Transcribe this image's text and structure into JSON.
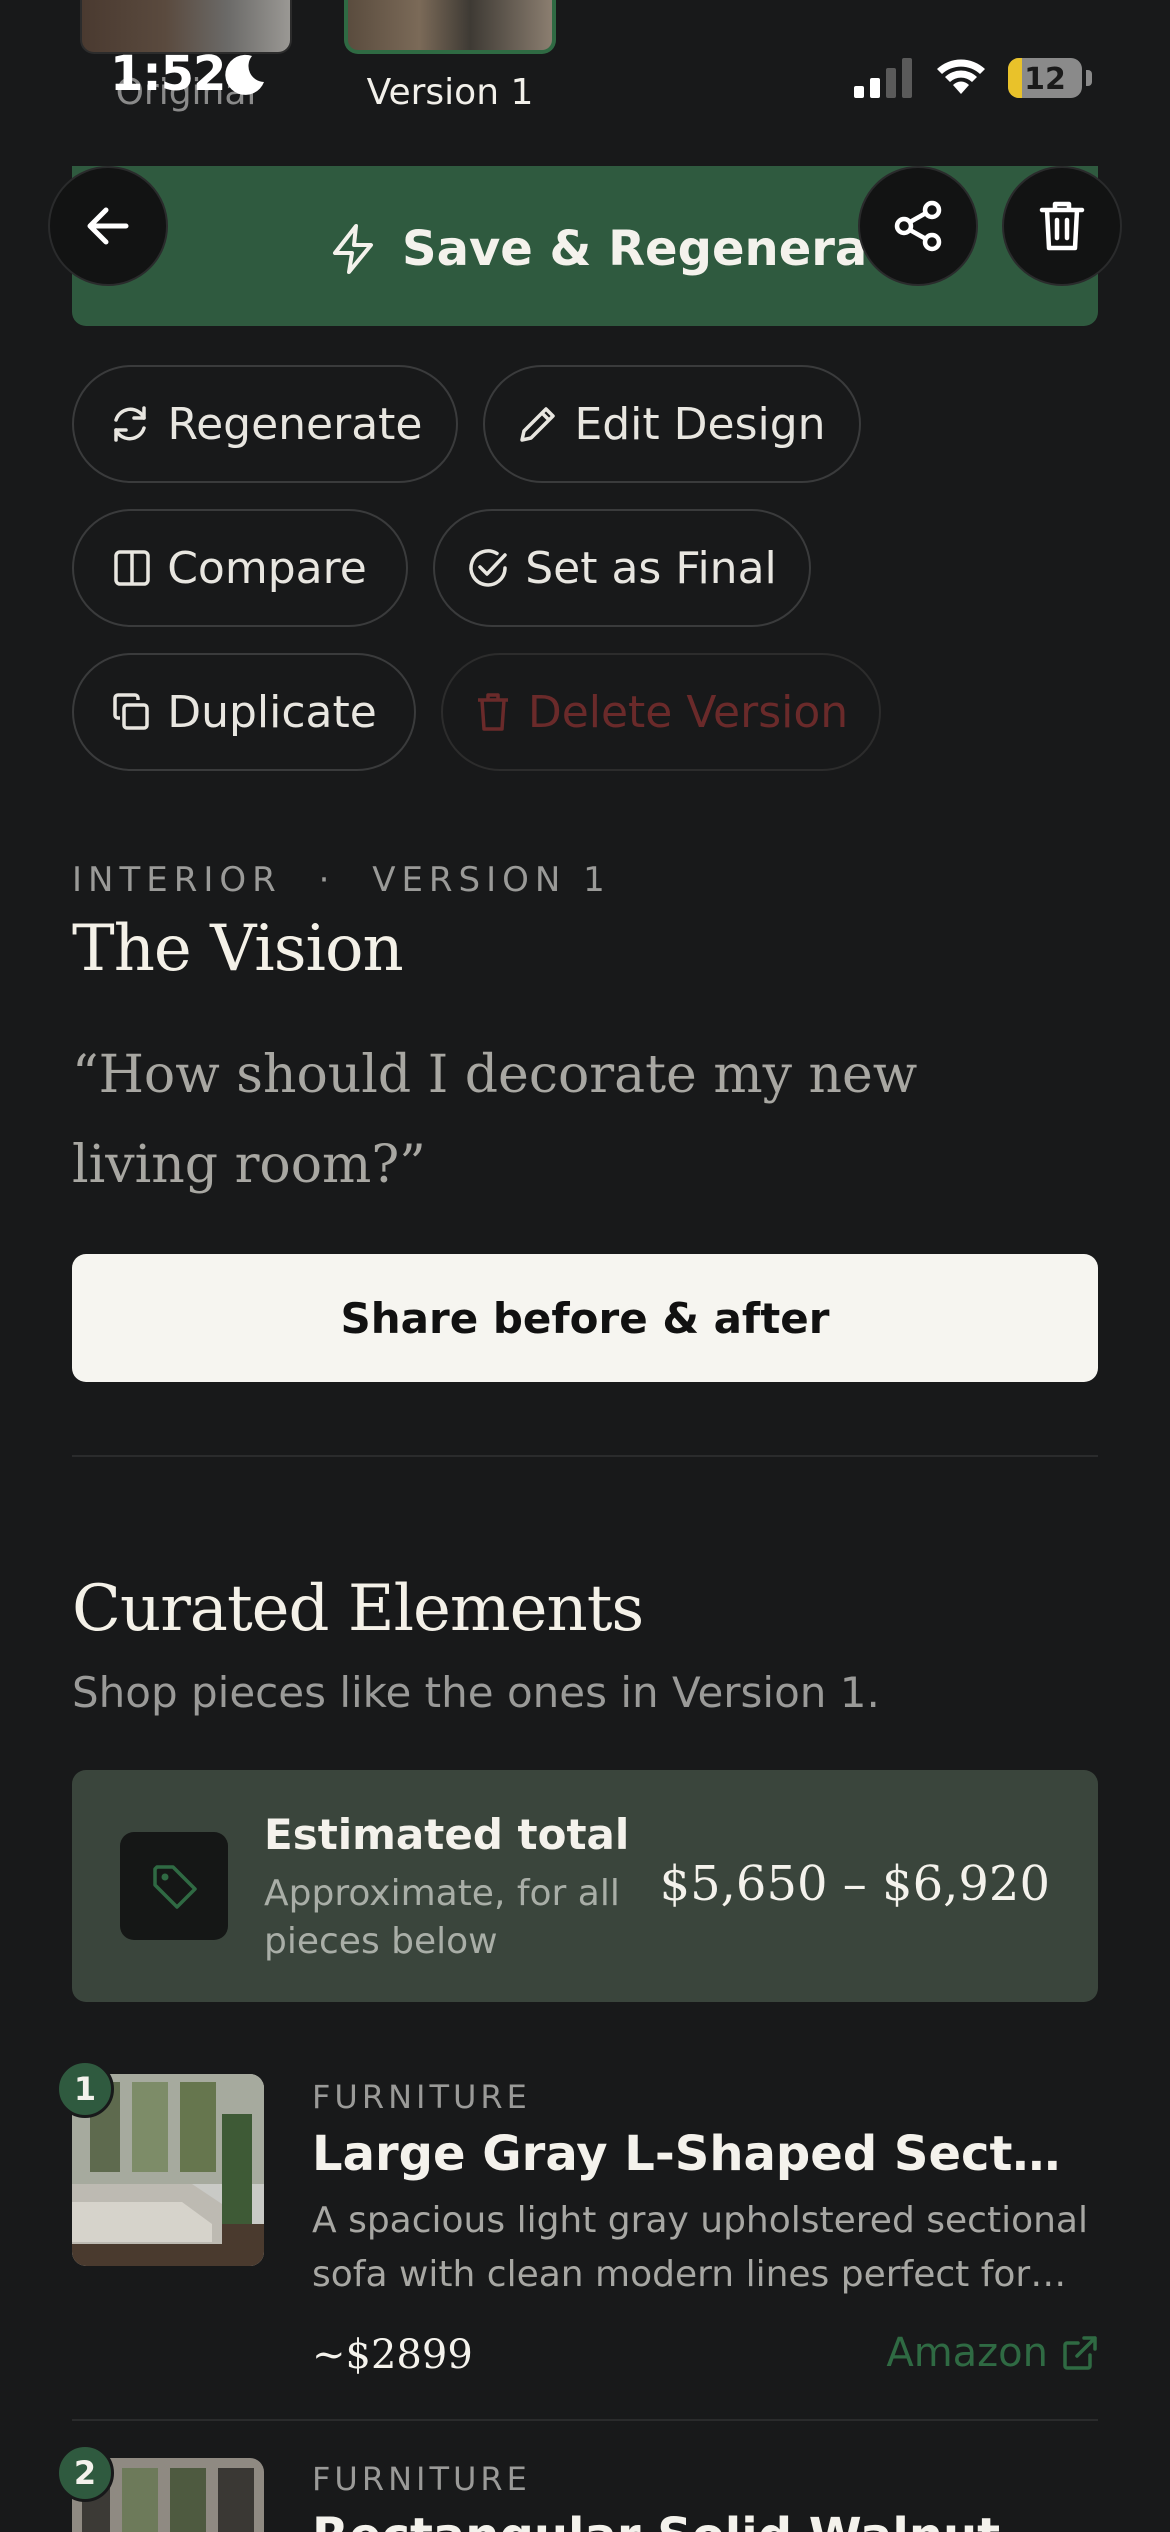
{
  "status_bar": {
    "time": "1:52",
    "battery": "12"
  },
  "thumbnails": [
    {
      "label": "Original"
    },
    {
      "label": "Version 1"
    }
  ],
  "toolbar": {
    "save_label": "Save & Regenerate"
  },
  "actions": {
    "regenerate": "Regenerate",
    "edit_design": "Edit Design",
    "compare": "Compare",
    "set_as_final": "Set as Final",
    "duplicate": "Duplicate",
    "delete_version": "Delete Version"
  },
  "vision": {
    "category": "INTERIOR",
    "separator": "·",
    "version": "VERSION 1",
    "title": "The Vision",
    "quote": "“How should I decorate my new living room?”",
    "share_label": "Share before & after"
  },
  "curated": {
    "title": "Curated Elements",
    "subtitle": "Shop pieces like the ones in Version 1.",
    "total_title": "Estimated total",
    "total_sub": "Approximate, for all pieces below",
    "total_price": "$5,650 – $6,920"
  },
  "products": [
    {
      "index": "1",
      "category": "FURNITURE",
      "name": "Large Gray L-Shaped Sectional Sofa",
      "description": "A spacious light gray upholstered sectional sofa with clean modern lines perfect for large living rooms",
      "price": "~$2899",
      "retailer": "Amazon"
    },
    {
      "index": "2",
      "category": "FURNITURE",
      "name": "Rectangular Solid Walnut Wood Coffee Table"
    }
  ],
  "colors": {
    "accent": "#2f5a3f",
    "background": "#18191a",
    "danger": "#6a2a2a"
  }
}
